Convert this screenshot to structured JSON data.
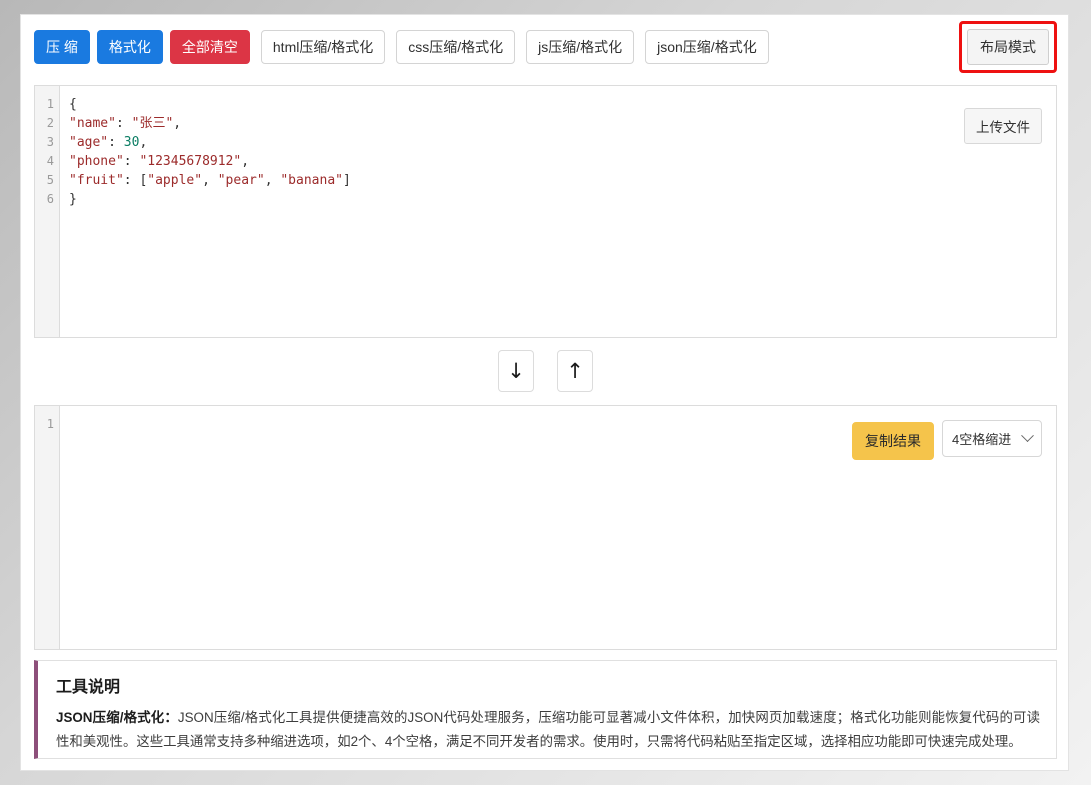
{
  "toolbar": {
    "compress_label": "压 缩",
    "format_label": "格式化",
    "clear_all_label": "全部清空",
    "html_tool_label": "html压缩/格式化",
    "css_tool_label": "css压缩/格式化",
    "js_tool_label": "js压缩/格式化",
    "json_tool_label": "json压缩/格式化",
    "layout_mode_label": "布局模式",
    "highlight_color": "#ee1111",
    "primary_color": "#1a7ae0",
    "danger_color": "#dc3545"
  },
  "input_editor": {
    "upload_label": "上传文件",
    "line_numbers": [
      "1",
      "2",
      "3",
      "4",
      "5",
      "6"
    ],
    "lines": [
      {
        "segments": [
          {
            "text": "{",
            "type": "punctuation"
          }
        ]
      },
      {
        "segments": [
          {
            "text": "\"name\"",
            "type": "string"
          },
          {
            "text": ": ",
            "type": "punctuation"
          },
          {
            "text": "\"张三\"",
            "type": "string"
          },
          {
            "text": ",",
            "type": "punctuation"
          }
        ]
      },
      {
        "segments": [
          {
            "text": "\"age\"",
            "type": "string"
          },
          {
            "text": ": ",
            "type": "punctuation"
          },
          {
            "text": "30",
            "type": "number"
          },
          {
            "text": ",",
            "type": "punctuation"
          }
        ]
      },
      {
        "segments": [
          {
            "text": "\"phone\"",
            "type": "string"
          },
          {
            "text": ": ",
            "type": "punctuation"
          },
          {
            "text": "\"12345678912\"",
            "type": "string"
          },
          {
            "text": ",",
            "type": "punctuation"
          }
        ]
      },
      {
        "segments": [
          {
            "text": "\"fruit\"",
            "type": "string"
          },
          {
            "text": ": [",
            "type": "punctuation"
          },
          {
            "text": "\"apple\"",
            "type": "string"
          },
          {
            "text": ", ",
            "type": "punctuation"
          },
          {
            "text": "\"pear\"",
            "type": "string"
          },
          {
            "text": ", ",
            "type": "punctuation"
          },
          {
            "text": "\"banana\"",
            "type": "string"
          },
          {
            "text": "]",
            "type": "punctuation"
          }
        ]
      },
      {
        "segments": [
          {
            "text": "}",
            "type": "punctuation"
          }
        ]
      }
    ]
  },
  "swap": {
    "down_arrow": "↓",
    "up_arrow": "↑"
  },
  "output_editor": {
    "copy_label": "复制结果",
    "indent_value": "4空格缩进",
    "line_numbers": [
      "1"
    ],
    "lines": [],
    "copy_button_color": "#f5c44b"
  },
  "description": {
    "title": "工具说明",
    "lead": "JSON压缩/格式化：",
    "body": "JSON压缩/格式化工具提供便捷高效的JSON代码处理服务，压缩功能可显著减小文件体积，加快网页加载速度；格式化功能则能恢复代码的可读性和美观性。这些工具通常支持多种缩进选项，如2个、4个空格，满足不同开发者的需求。使用时，只需将代码粘贴至指定区域，选择相应功能即可快速完成处理。",
    "accent_color": "#8d4f7a"
  }
}
